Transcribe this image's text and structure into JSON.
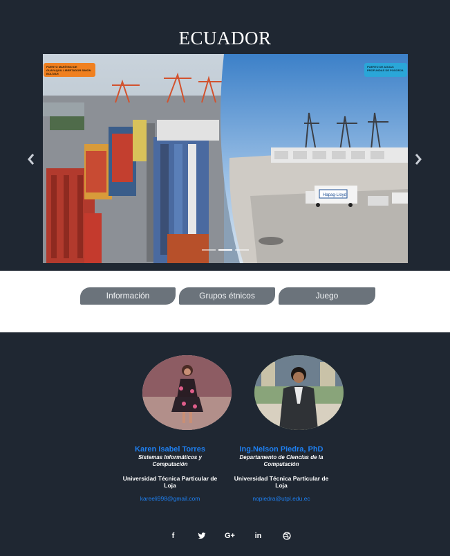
{
  "header": {
    "title": "ECUADOR"
  },
  "carousel": {
    "left_sign": "PUERTO MARÍTIMO DE GUAYAQUIL LIBERTADOR SIMÓN BOLÍVAR",
    "right_sign": "PUERTO DE AGUAS PROFUNDAS DE POSORJA",
    "truck_logo": "Hapag-Lloyd",
    "prev_icon": "chevron-left-icon",
    "next_icon": "chevron-right-icon",
    "indicators": [
      {
        "active": false
      },
      {
        "active": true
      },
      {
        "active": false
      }
    ]
  },
  "nav": {
    "tabs": [
      {
        "label": "Información"
      },
      {
        "label": "Grupos étnicos"
      },
      {
        "label": "Juego"
      }
    ]
  },
  "team": [
    {
      "name": "Karen Isabel Torres",
      "role": "Sistemas Informáticos y Computación",
      "university": "Universidad Técnica Particular de Loja",
      "email": "kareeli998@gmail.com"
    },
    {
      "name": "Ing.Nelson Piedra, PhD",
      "role": "Departamento de Ciencias de la Computación",
      "university": "Universidad Técnica Particular de Loja",
      "email": "nopiedra@utpl.edu.ec"
    }
  ],
  "social": [
    {
      "icon": "facebook-icon",
      "glyph": "f"
    },
    {
      "icon": "twitter-icon",
      "glyph": ""
    },
    {
      "icon": "google-plus-icon",
      "glyph": "G+"
    },
    {
      "icon": "linkedin-icon",
      "glyph": "in"
    },
    {
      "icon": "dribbble-icon",
      "glyph": ""
    }
  ],
  "colors": {
    "dark_bg": "#1f2732",
    "tab_bg": "#6b737b",
    "link_blue": "#1e7ff0"
  }
}
